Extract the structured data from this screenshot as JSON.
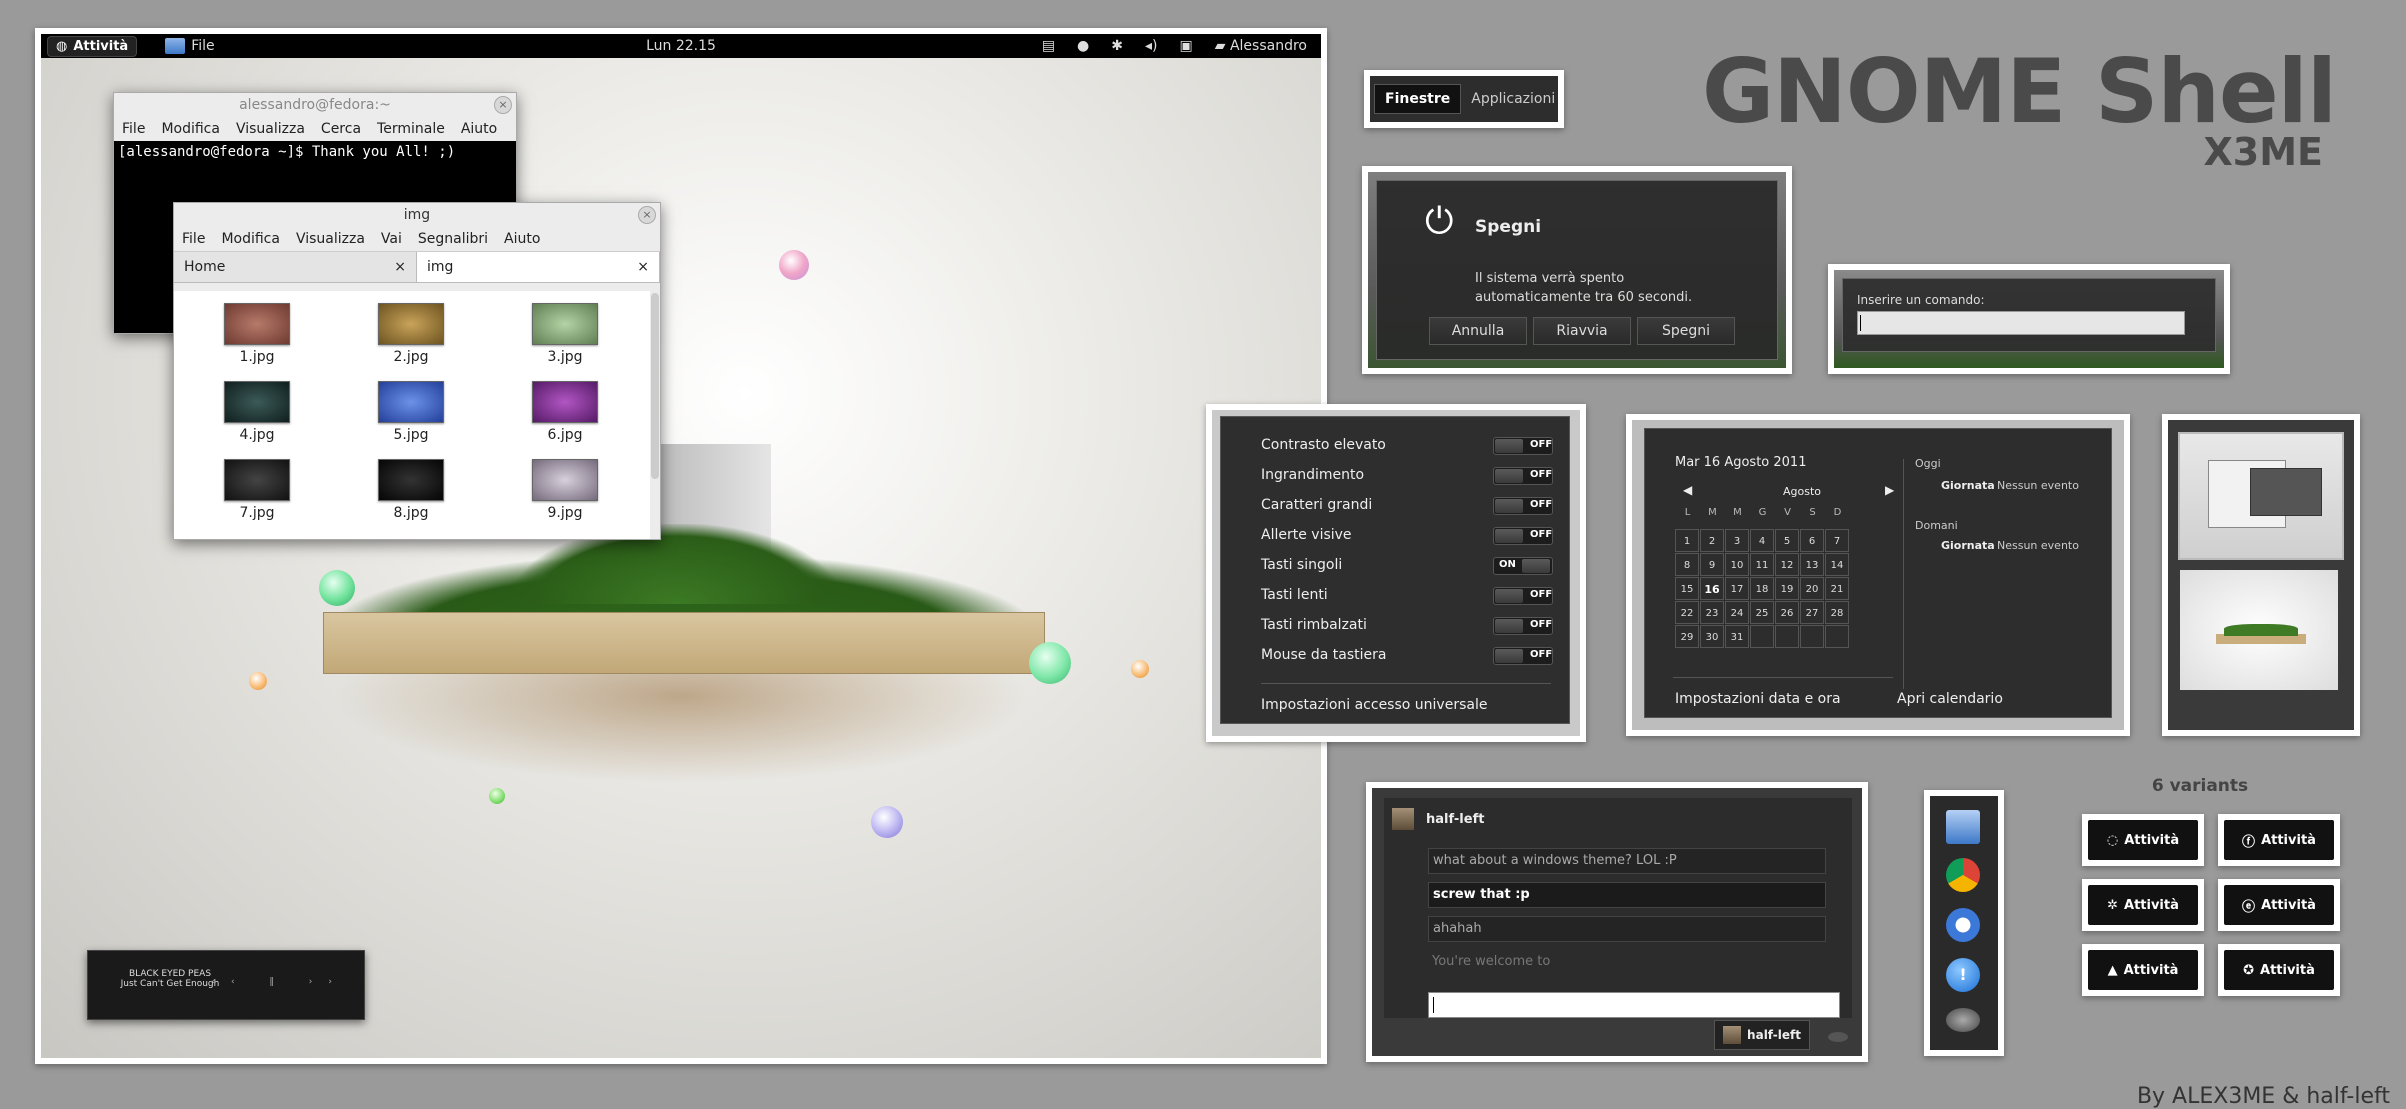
{
  "header": {
    "title": "GNOME Shell",
    "subtitle": "X3ME",
    "credit": "By ALEX3ME & half-left"
  },
  "topbar": {
    "activities": "Attività",
    "file_menu": "File",
    "clock": "Lun 22.15",
    "user": "Alessandro"
  },
  "terminal": {
    "title": "alessandro@fedora:~",
    "menu": [
      "File",
      "Modifica",
      "Visualizza",
      "Cerca",
      "Terminale",
      "Aiuto"
    ],
    "line": "[alessandro@fedora ~]$ Thank you All! ;)"
  },
  "filemanager": {
    "title": "img",
    "menu": [
      "File",
      "Modifica",
      "Visualizza",
      "Vai",
      "Segnalibri",
      "Aiuto"
    ],
    "tabs": [
      "Home",
      "img"
    ],
    "files": [
      "1.jpg",
      "2.jpg",
      "3.jpg",
      "4.jpg",
      "5.jpg",
      "6.jpg",
      "7.jpg",
      "8.jpg",
      "9.jpg"
    ]
  },
  "music": {
    "artist": "BLACK EYED PEAS",
    "track": "Just Can't Get Enough"
  },
  "overview_tabs": {
    "windows": "Finestre",
    "apps": "Applicazioni"
  },
  "power": {
    "title": "Spegni",
    "message": "Il sistema verrà spento automaticamente tra 60 secondi.",
    "cancel": "Annulla",
    "restart": "Riavvia",
    "shutdown": "Spegni"
  },
  "run": {
    "label": "Inserire un comando:"
  },
  "accessibility": {
    "items": [
      {
        "label": "Contrasto elevato",
        "state": "OFF"
      },
      {
        "label": "Ingrandimento",
        "state": "OFF"
      },
      {
        "label": "Caratteri grandi",
        "state": "OFF"
      },
      {
        "label": "Allerte visive",
        "state": "OFF"
      },
      {
        "label": "Tasti singoli",
        "state": "ON"
      },
      {
        "label": "Tasti lenti",
        "state": "OFF"
      },
      {
        "label": "Tasti rimbalzati",
        "state": "OFF"
      },
      {
        "label": "Mouse da tastiera",
        "state": "OFF"
      }
    ],
    "settings": "Impostazioni accesso universale"
  },
  "calendar": {
    "date": "Mar 16 Agosto 2011",
    "month": "Agosto",
    "weekdays": [
      "L",
      "M",
      "M",
      "G",
      "V",
      "S",
      "D"
    ],
    "days": [
      "1",
      "2",
      "3",
      "4",
      "5",
      "6",
      "7",
      "8",
      "9",
      "10",
      "11",
      "12",
      "13",
      "14",
      "15",
      "16",
      "17",
      "18",
      "19",
      "20",
      "21",
      "22",
      "23",
      "24",
      "25",
      "26",
      "27",
      "28",
      "29",
      "30",
      "31"
    ],
    "today": "16",
    "today_label": "Oggi",
    "tomorrow_label": "Domani",
    "all_day": "Giornata",
    "no_event": "Nessun evento",
    "settings": "Impostazioni data e ora",
    "open": "Apri calendario"
  },
  "chat": {
    "user": "half-left",
    "messages": [
      {
        "text": "what about a windows theme? LOL :P",
        "style": "normal"
      },
      {
        "text": "screw that :p",
        "style": "bold"
      },
      {
        "text": "ahahah",
        "style": "normal"
      },
      {
        "text": "You're welcome to",
        "style": "faded"
      }
    ],
    "footer_user": "half-left"
  },
  "variants": {
    "label": "6 variants",
    "button": "Attività"
  }
}
